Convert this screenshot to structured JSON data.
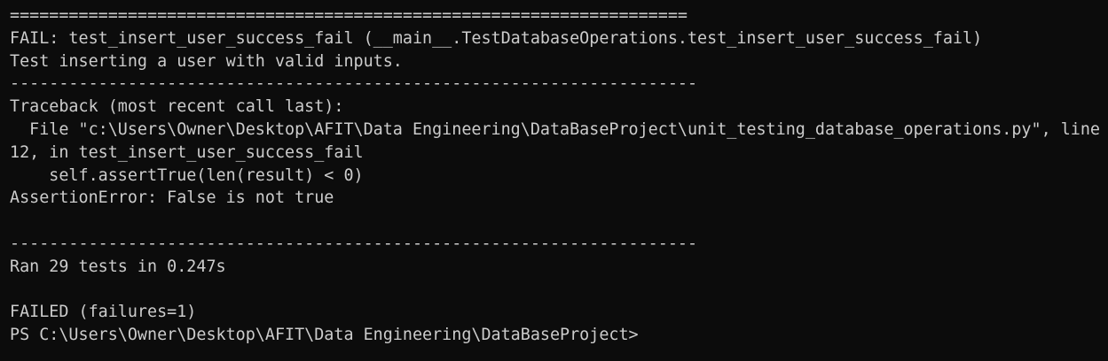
{
  "terminal": {
    "lines": [
      "=====================================================================",
      "FAIL: test_insert_user_success_fail (__main__.TestDatabaseOperations.test_insert_user_success_fail)",
      "Test inserting a user with valid inputs.",
      "----------------------------------------------------------------------",
      "Traceback (most recent call last):",
      "  File \"c:\\Users\\Owner\\Desktop\\AFIT\\Data Engineering\\DataBaseProject\\unit_testing_database_operations.py\", line",
      "12, in test_insert_user_success_fail",
      "    self.assertTrue(len(result) < 0)",
      "AssertionError: False is not true",
      "",
      "----------------------------------------------------------------------",
      "Ran 29 tests in 0.247s",
      "",
      "FAILED (failures=1)",
      "PS C:\\Users\\Owner\\Desktop\\AFIT\\Data Engineering\\DataBaseProject>"
    ]
  }
}
